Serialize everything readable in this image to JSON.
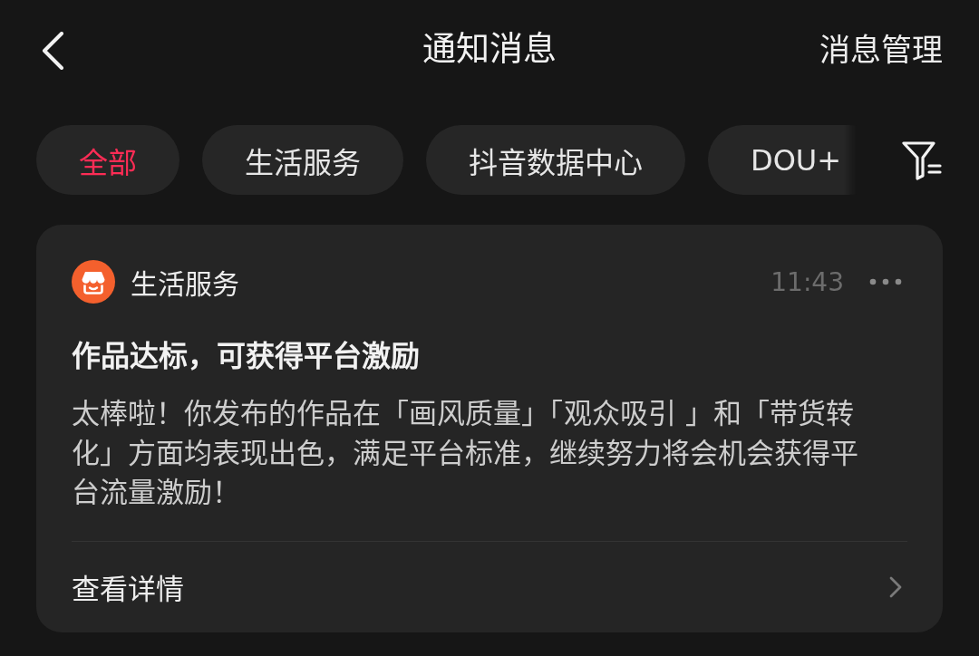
{
  "header": {
    "title": "通知消息",
    "action": "消息管理"
  },
  "tabs": [
    {
      "label": "全部",
      "selected": true
    },
    {
      "label": "生活服务",
      "selected": false
    },
    {
      "label": "抖音数据中心",
      "selected": false
    },
    {
      "label": "DOU+",
      "selected": false
    }
  ],
  "notification": {
    "source": "生活服务",
    "time": "11:43",
    "title": "作品达标，可获得平台激励",
    "body": "太棒啦！你发布的作品在「画风质量」「观众吸引 」和「带货转化」方面均表现出色，满足平台标准，继续努力将会机会获得平台流量激励！",
    "link": "查看详情"
  }
}
